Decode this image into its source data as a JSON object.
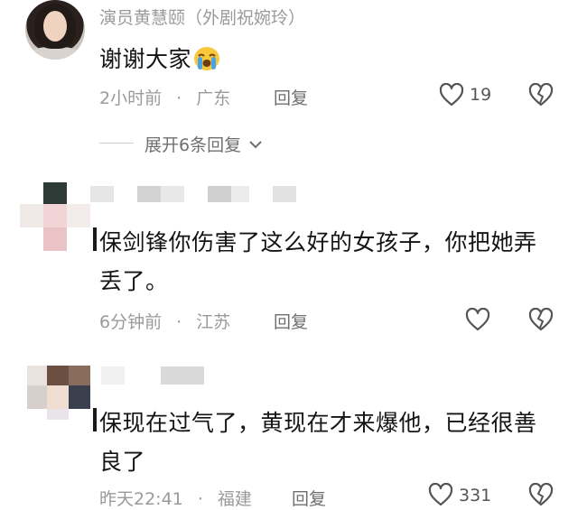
{
  "comments": [
    {
      "username": "演员黄慧颐（外剧祝婉玲）",
      "text": "谢谢大家",
      "emoji": "crying-face",
      "time": "2小时前",
      "location": "广东",
      "reply_label": "回复",
      "likes": "19"
    },
    {
      "username": "",
      "text_line1": "保剑锋你伤害了这么好的女孩子，你把她弄",
      "text_line2": "丢了。",
      "time": "6分钟前",
      "location": "江苏",
      "reply_label": "回复",
      "likes": ""
    },
    {
      "username": "",
      "text_line1": "保现在过气了，黄现在才来爆他，已经很善",
      "text_line2": "良了",
      "time": "昨天22:41",
      "location": "福建",
      "reply_label": "回复",
      "likes": "331"
    }
  ],
  "expand": {
    "label": "展开6条回复"
  },
  "separator": "·",
  "icons": {
    "like": "heart-outline-icon",
    "dislike": "broken-heart-icon",
    "expand": "chevron-down-icon"
  },
  "colors": {
    "meta": "#9a9a9a",
    "text": "#141414",
    "icon": "#555555"
  }
}
